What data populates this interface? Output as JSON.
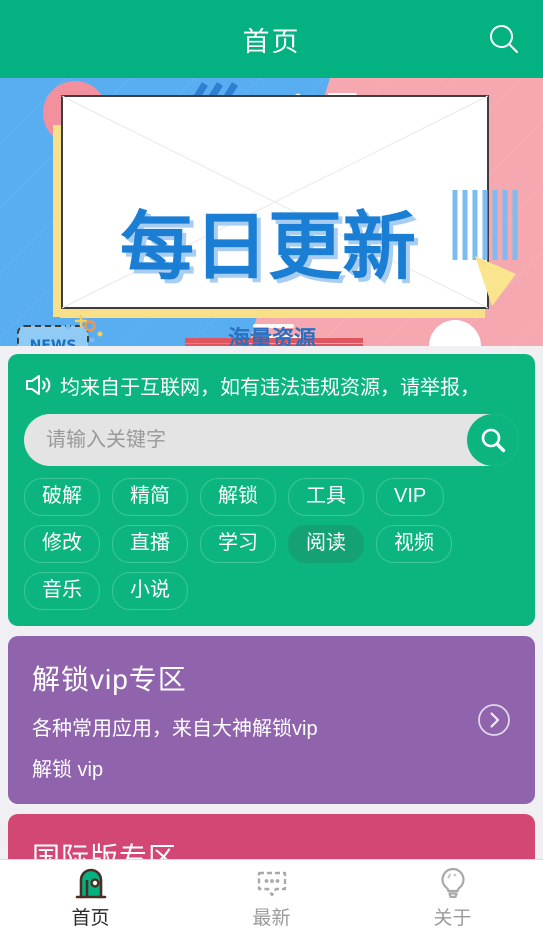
{
  "header": {
    "title": "首页",
    "search_icon": "search-icon"
  },
  "banner": {
    "main_text": "每日更新",
    "sub_text": "海量资源",
    "badge_text": "NEWS",
    "colors": {
      "left_bg": "#58aef0",
      "right_bg": "#f5a8b0",
      "card_bg": "#ffffff",
      "title_blue": "#1a7fd4",
      "underline_red": "#e0565c",
      "accent_yellow": "#f8e089"
    }
  },
  "notice": {
    "icon": "speaker-icon",
    "text": "均来自于互联网，如有违法违规资源，请举报，"
  },
  "search": {
    "placeholder": "请输入关键字",
    "value": "",
    "button_icon": "search-icon"
  },
  "tags": [
    {
      "label": "破解",
      "selected": false
    },
    {
      "label": "精简",
      "selected": false
    },
    {
      "label": "解锁",
      "selected": false
    },
    {
      "label": "工具",
      "selected": false
    },
    {
      "label": "VIP",
      "selected": false
    },
    {
      "label": "修改",
      "selected": false
    },
    {
      "label": "直播",
      "selected": false
    },
    {
      "label": "学习",
      "selected": false
    },
    {
      "label": "阅读",
      "selected": true
    },
    {
      "label": "视频",
      "selected": false
    },
    {
      "label": "音乐",
      "selected": false
    },
    {
      "label": "小说",
      "selected": false
    }
  ],
  "cards": [
    {
      "title": "解锁vip专区",
      "desc": "各种常用应用，来自大神解锁vip",
      "tag": "解锁 vip",
      "color": "#9063ad",
      "arrow_icon": "chevron-right-icon"
    },
    {
      "title": "国际版专区",
      "desc": "",
      "tag": "",
      "color": "#d34774",
      "arrow_icon": "chevron-right-icon"
    }
  ],
  "tabbar": [
    {
      "label": "首页",
      "icon": "home-door-icon",
      "active": true
    },
    {
      "label": "最新",
      "icon": "chat-bubble-icon",
      "active": false
    },
    {
      "label": "关于",
      "icon": "lightbulb-icon",
      "active": false
    }
  ],
  "colors": {
    "brand_green": "#04b180",
    "panel_green": "#0cb57f",
    "chip_border": "#3cc795",
    "chip_selected": "#14a174",
    "page_bg": "#efeff4"
  }
}
